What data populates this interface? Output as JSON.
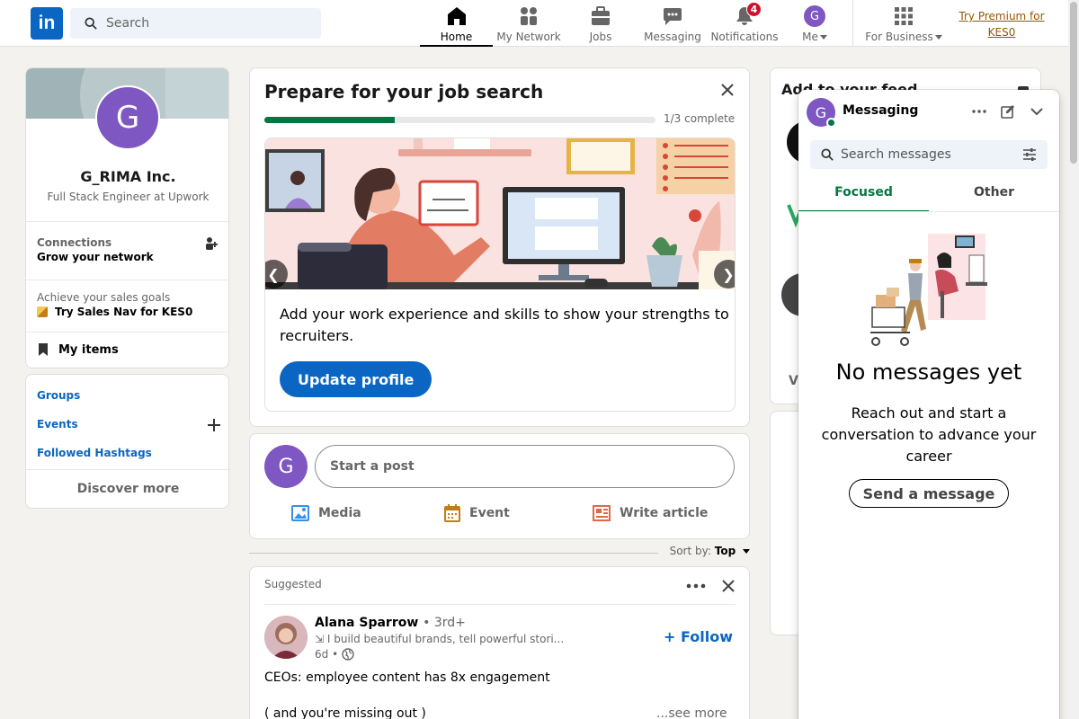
{
  "nav": {
    "logo": "in",
    "search_placeholder": "Search",
    "items": [
      {
        "label": "Home",
        "icon": "home-icon"
      },
      {
        "label": "My Network",
        "icon": "network-icon"
      },
      {
        "label": "Jobs",
        "icon": "briefcase-icon"
      },
      {
        "label": "Messaging",
        "icon": "chat-icon"
      },
      {
        "label": "Notifications",
        "icon": "bell-icon",
        "badge": "4"
      },
      {
        "label": "Me",
        "icon": "avatar"
      },
      {
        "label": "For Business",
        "icon": "grid-icon"
      }
    ],
    "avatar_initial": "G",
    "premium": "Try Premium for KES0"
  },
  "profile": {
    "initial": "G",
    "name": "G_RIMA Inc.",
    "headline": "Full Stack Engineer at Upwork",
    "connections_label": "Connections",
    "connections_sub": "Grow your network",
    "sales_label": "Achieve your sales goals",
    "sales_link": "Try Sales Nav for KES0",
    "my_items": "My items"
  },
  "links": {
    "groups": "Groups",
    "events": "Events",
    "hashtags": "Followed Hashtags",
    "discover": "Discover more"
  },
  "job_card": {
    "title": "Prepare for your job search",
    "progress_text": "1/3 complete",
    "progress_fraction": 0.333,
    "description": "Add your work experience and skills to show your strengths to recruiters.",
    "button": "Update profile",
    "prev": "❮",
    "next": "❯"
  },
  "post": {
    "initial": "G",
    "placeholder": "Start a post",
    "actions": [
      "Media",
      "Event",
      "Write article"
    ]
  },
  "sort": {
    "label": "Sort by:",
    "value": "Top"
  },
  "feed": {
    "header": "Suggested",
    "author": "Alana Sparrow",
    "degree": "• 3rd+",
    "headline": "⇲ I build beautiful brands, tell powerful stori...",
    "time": "6d •",
    "follow": "+ Follow",
    "text1": "CEOs: employee content has 8x engagement",
    "text2": "( and you're missing out )",
    "see_more": "...see more"
  },
  "right": {
    "title": "Add to your feed",
    "partial_text": "Vi"
  },
  "messaging": {
    "initial": "G",
    "title": "Messaging",
    "search_placeholder": "Search messages",
    "tabs": [
      "Focused",
      "Other"
    ],
    "empty_title": "No messages yet",
    "empty_desc": "Reach out and start a conversation to advance your career",
    "send": "Send a message"
  },
  "colors": {
    "brand": "#0a66c2",
    "success": "#057642",
    "premium": "#915907",
    "badge": "#cb112d"
  }
}
